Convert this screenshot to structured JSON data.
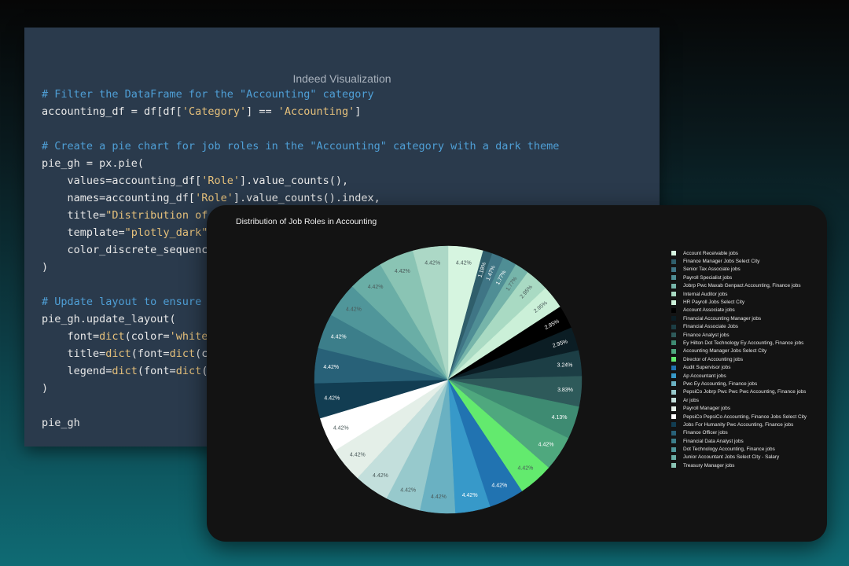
{
  "window": {
    "title": "Indeed Visualization"
  },
  "code": {
    "lines": [
      [
        {
          "t": "# Filter the DataFrame for the \"Accounting\" category",
          "c": "cm"
        }
      ],
      [
        {
          "t": "accounting_df = df[df[",
          "c": "nm"
        },
        {
          "t": "'Category'",
          "c": "st"
        },
        {
          "t": "] == ",
          "c": "nm"
        },
        {
          "t": "'Accounting'",
          "c": "st"
        },
        {
          "t": "]",
          "c": "nm"
        }
      ],
      [],
      [
        {
          "t": "# Create a pie chart for job roles in the \"Accounting\" category with a dark theme",
          "c": "cm"
        }
      ],
      [
        {
          "t": "pie_gh = px.pie(",
          "c": "nm"
        }
      ],
      [
        {
          "t": "    values=accounting_df[",
          "c": "nm"
        },
        {
          "t": "'Role'",
          "c": "st"
        },
        {
          "t": "].value_counts(),",
          "c": "nm"
        }
      ],
      [
        {
          "t": "    names=accounting_df[",
          "c": "nm"
        },
        {
          "t": "'Role'",
          "c": "st"
        },
        {
          "t": "].value_counts().index,",
          "c": "nm"
        }
      ],
      [
        {
          "t": "    title=",
          "c": "nm"
        },
        {
          "t": "\"Distribution of",
          "c": "st"
        }
      ],
      [
        {
          "t": "    template=",
          "c": "nm"
        },
        {
          "t": "\"plotly_dark\"",
          "c": "st"
        }
      ],
      [
        {
          "t": "    color_discrete_sequenc",
          "c": "nm"
        }
      ],
      [
        {
          "t": ")",
          "c": "nm"
        }
      ],
      [],
      [
        {
          "t": "# Update layout to ensure",
          "c": "cm"
        }
      ],
      [
        {
          "t": "pie_gh.update_layout(",
          "c": "nm"
        }
      ],
      [
        {
          "t": "    font=",
          "c": "nm"
        },
        {
          "t": "dict",
          "c": "kw"
        },
        {
          "t": "(color=",
          "c": "nm"
        },
        {
          "t": "'white",
          "c": "st"
        }
      ],
      [
        {
          "t": "    title=",
          "c": "nm"
        },
        {
          "t": "dict",
          "c": "kw"
        },
        {
          "t": "(font=",
          "c": "nm"
        },
        {
          "t": "dict",
          "c": "kw"
        },
        {
          "t": "(c",
          "c": "nm"
        }
      ],
      [
        {
          "t": "    legend=",
          "c": "nm"
        },
        {
          "t": "dict",
          "c": "kw"
        },
        {
          "t": "(font=",
          "c": "nm"
        },
        {
          "t": "dict",
          "c": "kw"
        },
        {
          "t": "(",
          "c": "nm"
        }
      ],
      [
        {
          "t": ")",
          "c": "nm"
        }
      ],
      [],
      [
        {
          "t": "pie_gh",
          "c": "nm"
        }
      ]
    ]
  },
  "chart_data": {
    "type": "pie",
    "title": "Distribution of Job Roles in Accounting",
    "slices": [
      {
        "label": "Account Receivable jobs",
        "pct": "4.42%",
        "value": 4.42,
        "color": "#d6f5e0"
      },
      {
        "label": "Finance Manager Jobs Select City",
        "pct": "1.18%",
        "value": 1.18,
        "color": "#2f5e6b"
      },
      {
        "label": "Senior Tax Associate jobs",
        "pct": "1.47%",
        "value": 1.47,
        "color": "#3f7585"
      },
      {
        "label": "Payroll Specialist jobs",
        "pct": "1.77%",
        "value": 1.77,
        "color": "#4f8e95"
      },
      {
        "label": "Jobrp Pwc Maxab Genpact Accounting, Finance jobs",
        "pct": "1.77%",
        "value": 1.77,
        "color": "#76b5aa"
      },
      {
        "label": "Internal Auditor jobs",
        "pct": "2.95%",
        "value": 2.95,
        "color": "#a9dac3"
      },
      {
        "label": "HR Payroll Jobs Select City",
        "pct": "2.95%",
        "value": 2.95,
        "color": "#cbf0d8"
      },
      {
        "label": "Account Associate jobs",
        "pct": "2.95%",
        "value": 2.95,
        "color": "#000000"
      },
      {
        "label": "Financial Accounting Manager jobs",
        "pct": "2.95%",
        "value": 2.95,
        "color": "#0b1d24"
      },
      {
        "label": "Financial Associate Jobs",
        "pct": "3.24%",
        "value": 3.24,
        "color": "#1c3e45"
      },
      {
        "label": "Finance Analyst jobs",
        "pct": "3.83%",
        "value": 3.83,
        "color": "#2e5a5a"
      },
      {
        "label": "Ey Hilton Dot Technology Ey Accounting, Finance jobs",
        "pct": "4.13%",
        "value": 4.13,
        "color": "#3e8b72"
      },
      {
        "label": "Accounting Manager Jobs Select City",
        "pct": "4.42%",
        "value": 4.42,
        "color": "#4fa87e"
      },
      {
        "label": "Director of Accounting jobs",
        "pct": "4.42%",
        "value": 4.42,
        "color": "#63ea6e"
      },
      {
        "label": "Audit Supervisor jobs",
        "pct": "4.42%",
        "value": 4.42,
        "color": "#2173b1"
      },
      {
        "label": "Ap Accountant jobs",
        "pct": "4.42%",
        "value": 4.42,
        "color": "#3799c9"
      },
      {
        "label": "Pwc Ey Accounting, Finance jobs",
        "pct": "4.42%",
        "value": 4.42,
        "color": "#6ab1c2"
      },
      {
        "label": "PepsiCo Jobrp Pwc Pwc Pwc Accounting, Finance jobs",
        "pct": "4.42%",
        "value": 4.42,
        "color": "#97c9cc"
      },
      {
        "label": "Ar jobs",
        "pct": "4.42%",
        "value": 4.42,
        "color": "#c3dfdc"
      },
      {
        "label": "Payroll Manager jobs",
        "pct": "4.42%",
        "value": 4.42,
        "color": "#e4efe8"
      },
      {
        "label": "PepsiCo PepsiCo Accounting, Finance Jobs Select City",
        "pct": "4.42%",
        "value": 4.42,
        "color": "#ffffff"
      },
      {
        "label": "Jobs For Humanity Pwc Accounting, Finance jobs",
        "pct": "4.42%",
        "value": 4.42,
        "color": "#123d52"
      },
      {
        "label": "Finance Officer jobs",
        "pct": "4.42%",
        "value": 4.42,
        "color": "#286178"
      },
      {
        "label": "Financial Data Analyst jobs",
        "pct": "4.42%",
        "value": 4.42,
        "color": "#3c7e8a"
      },
      {
        "label": "Dot Technology Accounting, Finance jobs",
        "pct": "4.42%",
        "value": 4.42,
        "color": "#50969a"
      },
      {
        "label": "Junior Accountant Jobs Select City - Salary",
        "pct": "4.42%",
        "value": 4.42,
        "color": "#6aaea6"
      },
      {
        "label": "Treasury Manager jobs",
        "pct": "4.42%",
        "value": 4.42,
        "color": "#8ac4b4"
      },
      {
        "label": "",
        "pct": "4.42%",
        "value": 4.42,
        "color": "#acd8c6"
      }
    ],
    "legend_position": "right"
  },
  "colors": {
    "card_bg": "#131313",
    "code_bg": "#2a3a4c"
  }
}
